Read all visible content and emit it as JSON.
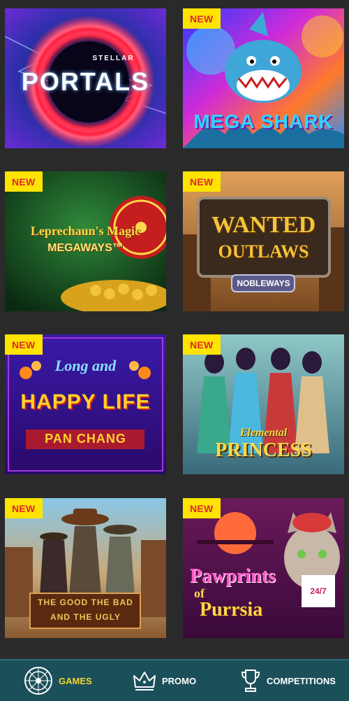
{
  "games": [
    {
      "title_line1": "STELLAR",
      "title_line2": "PORTALS",
      "new": false
    },
    {
      "title": "MEGA SHARK",
      "badge": "NEW",
      "new": true
    },
    {
      "title_line1": "Leprechaun's Magic",
      "title_line2": "MEGAWAYS™",
      "badge": "NEW",
      "new": true
    },
    {
      "title_line1": "WANTED",
      "title_line2": "OUTLAWS",
      "title_line3": "NOBLEWAYS",
      "badge": "NEW",
      "new": true
    },
    {
      "title_line1": "Long and",
      "title_line2": "HAPPY LIFE",
      "title_line3": "PAN CHANG",
      "badge": "NEW",
      "new": true
    },
    {
      "title_line1": "Elemental",
      "title_line2": "PRINCESS",
      "badge": "NEW",
      "new": true
    },
    {
      "title_line1": "THE GOOD THE BAD",
      "title_line2": "AND THE UGLY",
      "badge": "NEW",
      "new": true
    },
    {
      "title_line1": "Pawprints",
      "title_line2": "of",
      "title_line3": "Purrsia",
      "tag": "24/7",
      "badge": "NEW",
      "new": true
    }
  ],
  "nav": {
    "games_label": "GAMES",
    "promo_label": "PROMO",
    "competitions_label": "COMPETITIONS"
  },
  "colors": {
    "background": "#2a2a2a",
    "navbar": "#1b4f5a",
    "active_nav": "#f2d72c",
    "badge_bg": "#ffe400",
    "badge_text": "#e0262b"
  },
  "icons": {
    "games": "roulette-wheel-icon",
    "promo": "crown-icon",
    "competitions": "trophy-icon"
  }
}
